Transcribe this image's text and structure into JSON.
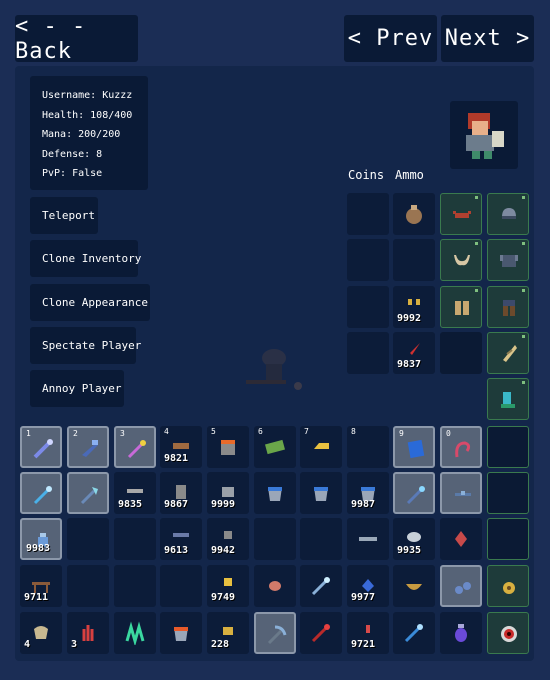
{
  "nav": {
    "back": "< - - Back",
    "prev": "< Prev",
    "next": "Next >"
  },
  "player": {
    "username": "Username: Kuzzz",
    "health": "Health: 108/400",
    "mana": "Mana: 200/200",
    "defense": "Defense: 8",
    "pvp": "PvP: False"
  },
  "actions": [
    "Teleport",
    "Clone Inventory",
    "Clone Appearance",
    "Spectate Player",
    "Annoy Player"
  ],
  "labels": {
    "coins": "Coins",
    "ammo": "Ammo"
  },
  "hotbar": [
    "1",
    "2",
    "3",
    "4",
    "5",
    "6",
    "7",
    "8",
    "9",
    "0"
  ],
  "inventory": {
    "row1": [
      "",
      "",
      "",
      "9821",
      "",
      "",
      "",
      "",
      "",
      ""
    ],
    "row2": [
      "",
      "",
      "9835",
      "9867",
      "9999",
      "",
      "",
      "9987",
      "",
      ""
    ],
    "row3": [
      "9983",
      "",
      "",
      "9613",
      "9942",
      "",
      "",
      "",
      "9935",
      ""
    ],
    "row4": [
      "9711",
      "",
      "",
      "",
      "9749",
      "",
      "",
      "9977",
      "",
      ""
    ],
    "row5": [
      "4",
      "3",
      "",
      "",
      "228",
      "",
      "",
      "9721",
      "",
      ""
    ]
  },
  "ammo": [
    "",
    "",
    "9992",
    "9837"
  ],
  "icon_names": [
    "wand-icon",
    "gun-icon",
    "staff-icon",
    "wood-icon",
    "pot-icon",
    "cash-icon",
    "bar-icon",
    "empty",
    "book-icon",
    "whip-icon"
  ]
}
